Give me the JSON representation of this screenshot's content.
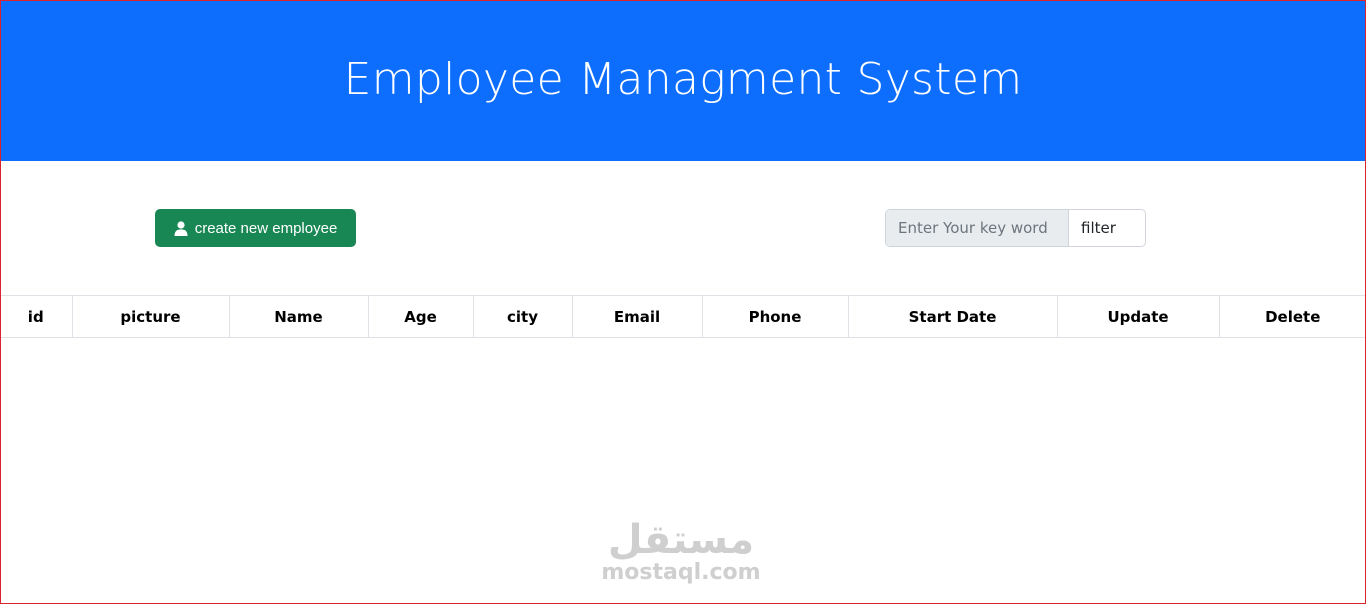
{
  "header": {
    "title": "Employee Managment System"
  },
  "toolbar": {
    "create_label": "create new employee",
    "search_placeholder": "Enter Your key word",
    "filter_label": "filter"
  },
  "table": {
    "columns": [
      "id",
      "picture",
      "Name",
      "Age",
      "city",
      "Email",
      "Phone",
      "Start Date",
      "Update",
      "Delete"
    ],
    "rows": []
  },
  "watermark": {
    "arabic": "مستقل",
    "latin": "mostaql.com"
  },
  "colors": {
    "header": "#0d6efd",
    "create_button": "#198754"
  },
  "icons": {
    "create_button": "person-icon"
  }
}
